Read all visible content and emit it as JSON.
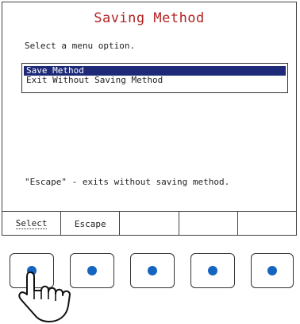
{
  "screen": {
    "title": "Saving Method",
    "prompt": "Select a menu option.",
    "menu": [
      {
        "label": "Save Method",
        "selected": true
      },
      {
        "label": "Exit Without Saving Method",
        "selected": false
      }
    ],
    "hint": "\"Escape\" - exits without saving method."
  },
  "softkeys": [
    "Select",
    "Escape",
    "",
    "",
    ""
  ],
  "hardware_buttons": 5,
  "colors": {
    "title": "#b22222",
    "selection": "#1e2a78",
    "button_dot": "#1565c0"
  },
  "icons": {
    "pointer": "pointing-hand-icon"
  }
}
